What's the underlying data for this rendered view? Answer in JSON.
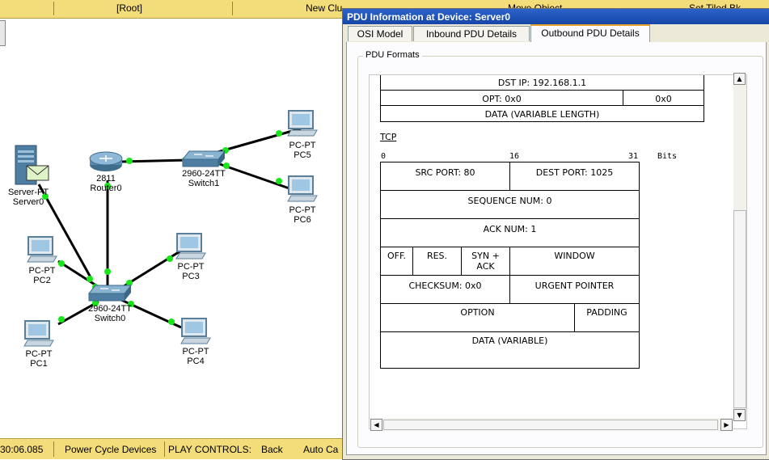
{
  "topbar": {
    "root": "[Root]",
    "new_cluster": "New Clu",
    "move_object": "Move Object",
    "set_tiled": "Set Tiled Bk"
  },
  "status": {
    "time": "30:06.085",
    "power_cycle": "Power Cycle Devices",
    "play_controls": "PLAY CONTROLS:",
    "back": "Back",
    "auto_capture": "Auto Ca"
  },
  "devices": {
    "server0": {
      "type": "Server-PT",
      "name": "Server0"
    },
    "router0": {
      "type": "2811",
      "name": "Router0"
    },
    "switch1": {
      "type": "2960-24TT",
      "name": "Switch1"
    },
    "switch0": {
      "type": "2960-24TT",
      "name": "Switch0"
    },
    "pc1": {
      "type": "PC-PT",
      "name": "PC1"
    },
    "pc2": {
      "type": "PC-PT",
      "name": "PC2"
    },
    "pc3": {
      "type": "PC-PT",
      "name": "PC3"
    },
    "pc4": {
      "type": "PC-PT",
      "name": "PC4"
    },
    "pc5": {
      "type": "PC-PT",
      "name": "PC5"
    },
    "pc6": {
      "type": "PC-PT",
      "name": "PC6"
    }
  },
  "colors": {
    "link": "#000000",
    "link_light": "#00e600",
    "toolbar": "#f3dc7a",
    "titlebar": "#1f50b8",
    "tab_highlight": "#e5a228"
  },
  "dialog": {
    "title": "PDU Information at Device: Server0",
    "tabs": [
      {
        "label": "OSI Model"
      },
      {
        "label": "Inbound PDU Details"
      },
      {
        "label": "Outbound PDU Details",
        "active": true
      }
    ],
    "group_label": "PDU Formats",
    "ip": {
      "dst_ip": "DST IP: 192.168.1.1",
      "opt": "OPT: 0x0",
      "padding": "0x0",
      "data": "DATA (VARIABLE LENGTH)"
    },
    "tcp": {
      "header": "TCP",
      "ruler": {
        "start": "0",
        "mid": "16",
        "end": "31",
        "unit": "Bits"
      },
      "src_port": "SRC PORT: 80",
      "dest_port": "DEST PORT: 1025",
      "seq": "SEQUENCE NUM: 0",
      "ack": "ACK NUM: 1",
      "off": "OFF.",
      "res": "RES.",
      "syn_ack": "SYN + ACK",
      "window": "WINDOW",
      "checksum": "CHECKSUM: 0x0",
      "urgent": "URGENT POINTER",
      "option": "OPTION",
      "padding": "PADDING",
      "data": "DATA (VARIABLE)"
    }
  }
}
